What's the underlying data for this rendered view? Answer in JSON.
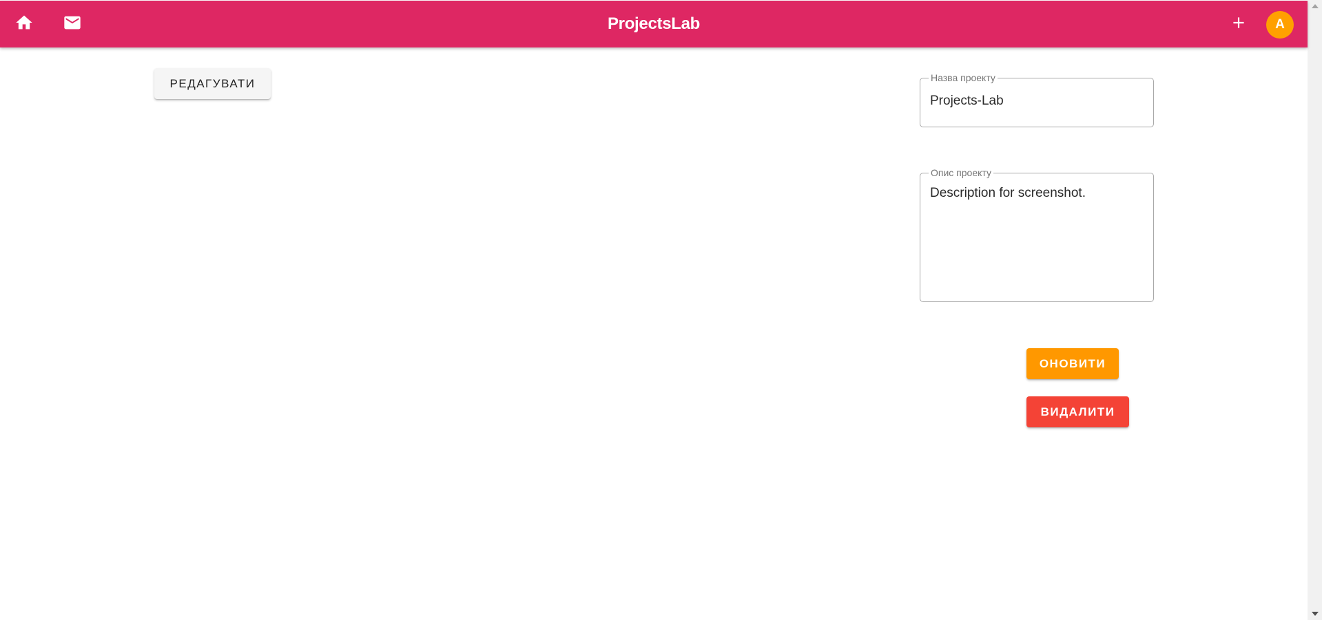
{
  "app": {
    "title": "ProjectsLab",
    "accent_color": "#de2763"
  },
  "header": {
    "icons": {
      "home": "home-icon",
      "mail": "mail-icon",
      "add": "plus-icon"
    },
    "avatar": {
      "initial": "A",
      "color": "#ffa000"
    }
  },
  "toolbar": {
    "edit_label": "РЕДАГУВАТИ"
  },
  "form": {
    "name": {
      "label": "Назва проекту",
      "value": "Projects-Lab"
    },
    "description": {
      "label": "Опис проекту",
      "value": "Description for screenshot."
    },
    "update_label": "ОНОВИТИ",
    "update_color": "#ff9800",
    "delete_label": "ВИДАЛИТИ",
    "delete_color": "#f44336"
  }
}
